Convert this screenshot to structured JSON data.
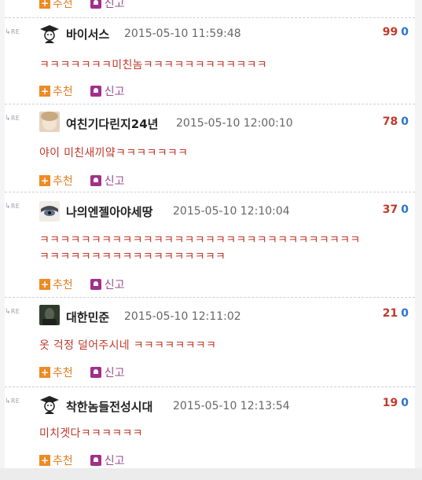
{
  "actions": {
    "recommend": "추천",
    "report": "신고"
  },
  "reply_tag": "RE",
  "comments": [
    {
      "nickname": "바이서스",
      "date": "2015-05-10 11:59:48",
      "up": "99",
      "down": "0",
      "lines": [
        "ㅋㅋㅋㅋㅋㅋㅋ미친놈ㅋㅋㅋㅋㅋㅋㅋㅋㅋㅋㅋㅋ"
      ],
      "avatar": "scholar-cap-avatar"
    },
    {
      "nickname": "여친기다린지24년",
      "date": "2015-05-10 12:00:10",
      "up": "78",
      "down": "0",
      "lines": [
        "야이 미친새끼얔ㅋㅋㅋㅋㅋㅋㅋ"
      ],
      "avatar": "photo-avatar"
    },
    {
      "nickname": "나의엔젤아야세땅",
      "date": "2015-05-10 12:10:04",
      "up": "37",
      "down": "0",
      "lines": [
        "ㅋㅋㅋㅋㅋㅋㅋㅋㅋㅋㅋㅋㅋㅋㅋㅋㅋㅋㅋㅋㅋㅋㅋㅋㅋㅋㅋㅋㅋㅋㅋ",
        "ㅋㅋㅋㅋㅋㅋㅋㅋㅋㅋㅋㅋㅋㅋㅋㅋㅋㅋ"
      ],
      "avatar": "anime-eye-avatar"
    },
    {
      "nickname": "대한민준",
      "date": "2015-05-10 12:11:02",
      "up": "21",
      "down": "0",
      "lines": [
        "옷 걱정 덜어주시네 ㅋㅋㅋㅋㅋㅋㅋㅋ"
      ],
      "avatar": "dark-photo-avatar"
    },
    {
      "nickname": "착한놈들전성시대",
      "date": "2015-05-10 12:13:54",
      "up": "19",
      "down": "0",
      "lines": [
        "미치겟다ㅋㅋㅋㅋㅋㅋ"
      ],
      "avatar": "scholar-cap-avatar"
    }
  ],
  "colors": {
    "recommend": "#f08a24",
    "report": "#a0308c",
    "upvote": "#c0392b",
    "downvote": "#2c74c9",
    "body_text": "#c0392b"
  }
}
